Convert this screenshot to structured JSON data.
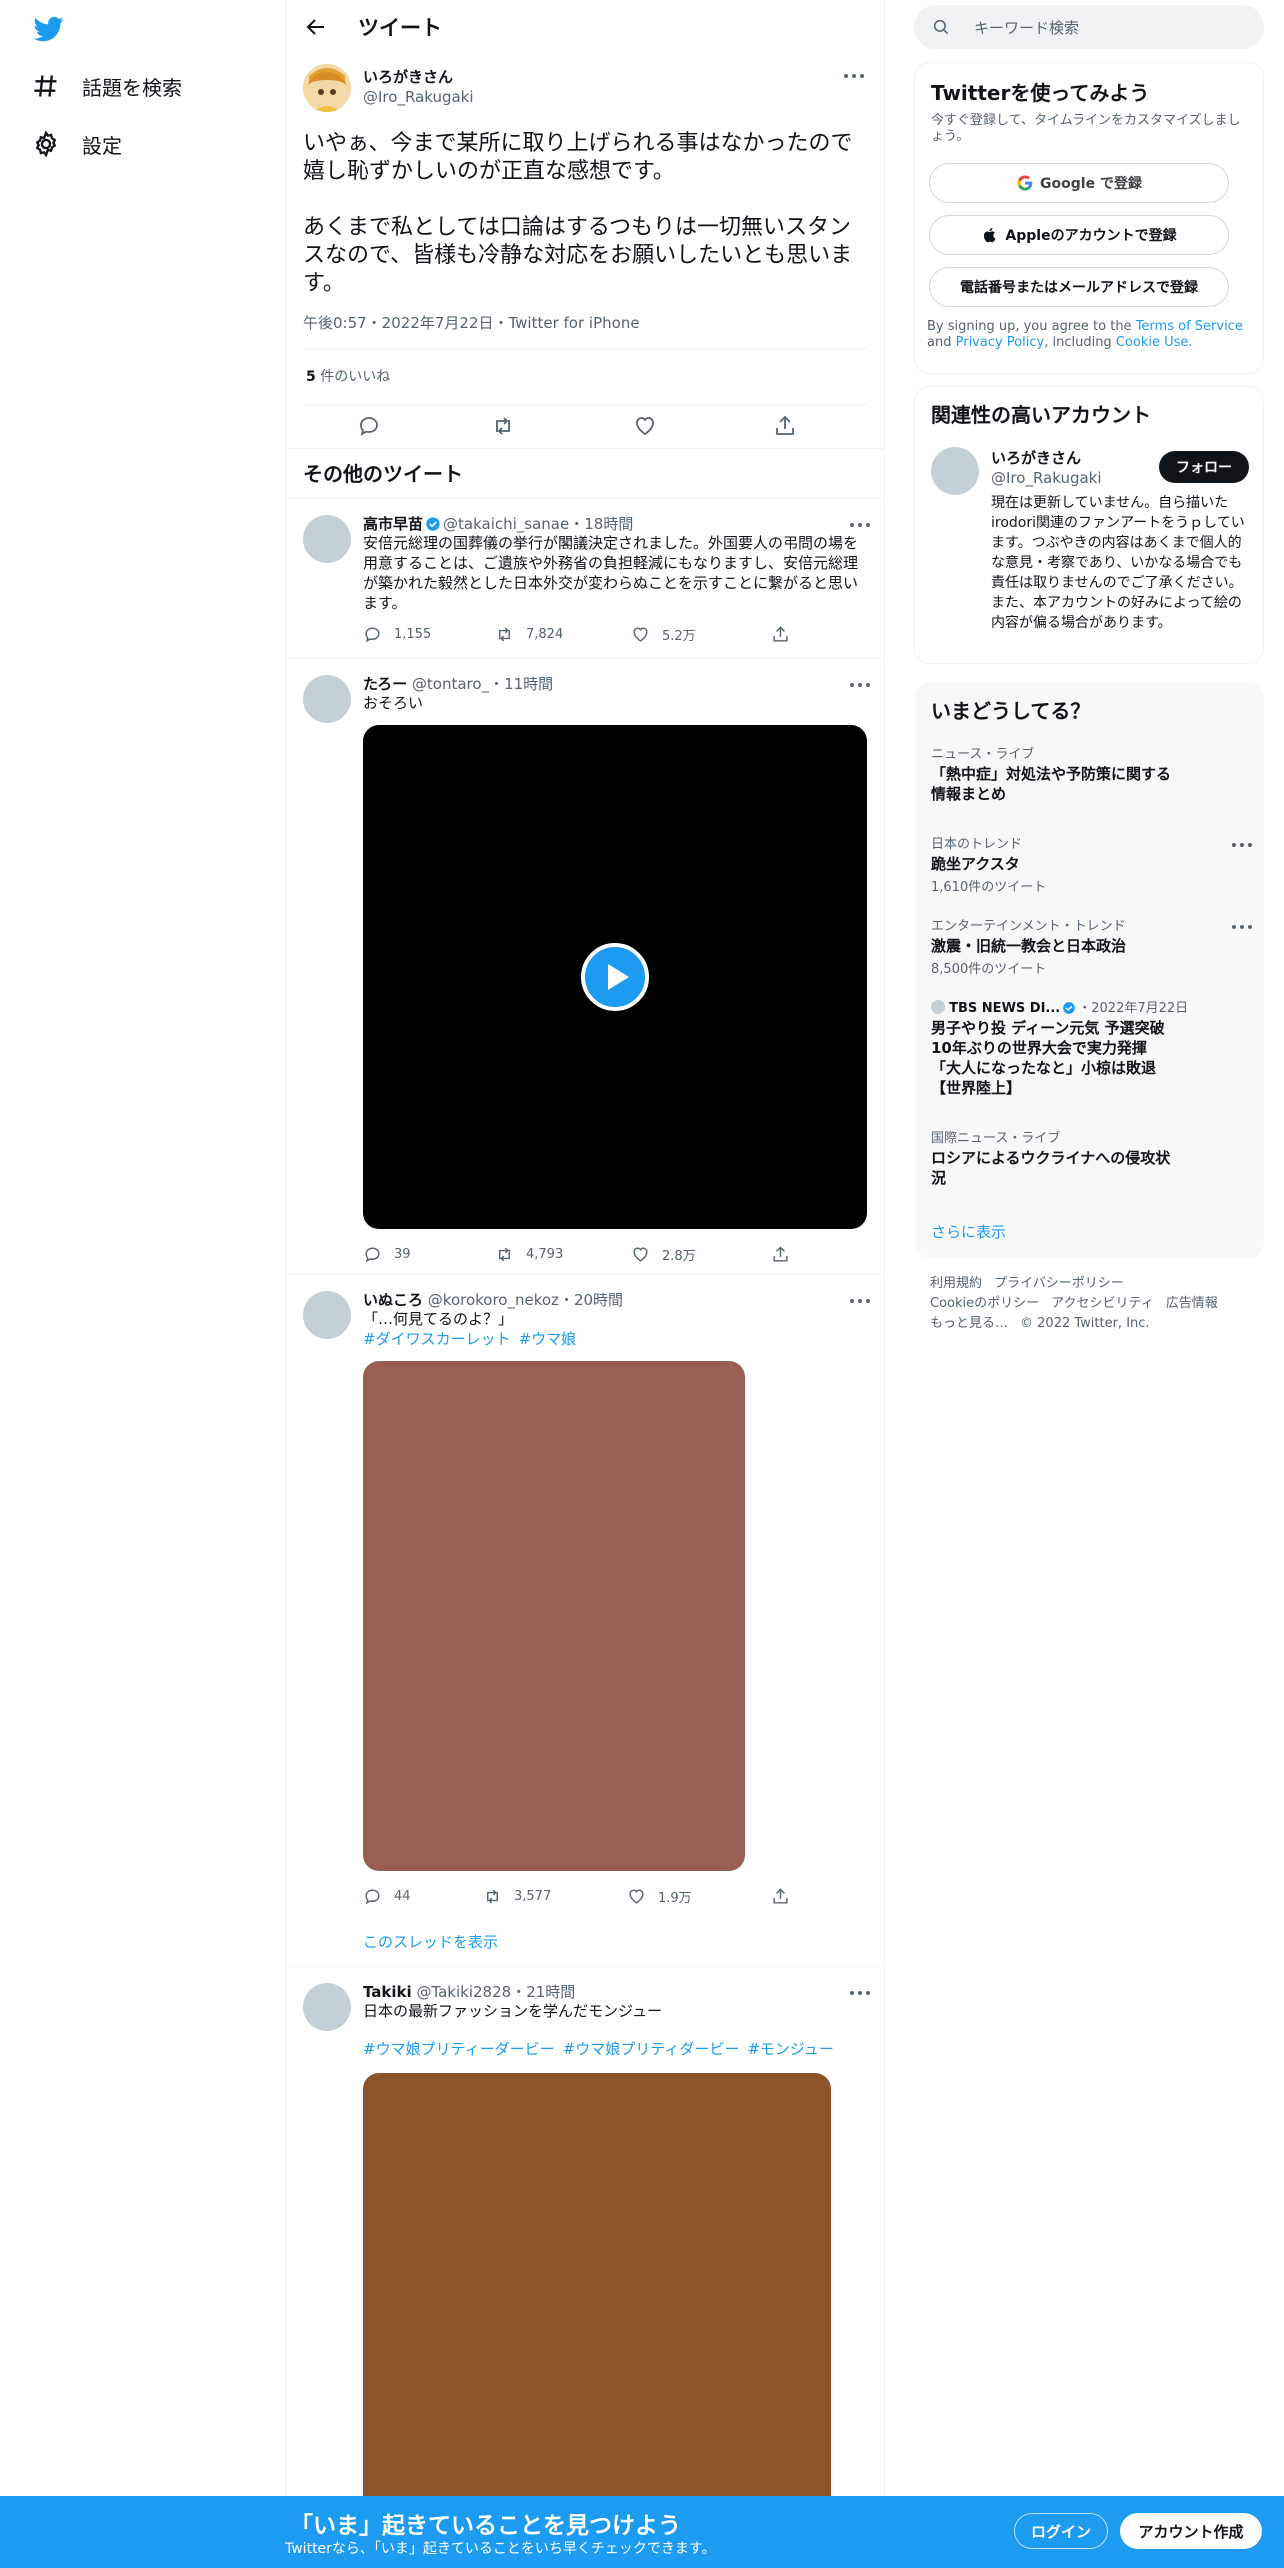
{
  "nav": {
    "logo": "twitter-bird-icon",
    "explore_label": "話題を検索",
    "settings_label": "設定"
  },
  "header": {
    "title": "ツイート"
  },
  "main_tweet": {
    "name": "いろがきさん",
    "handle": "@Iro_Rakugaki",
    "text": "いやぁ、今まで某所に取り上げられる事はなかったので嬉し恥ずかしいのが正直な感想です。\n\nあくまで私としては口論はするつもりは一切無いスタンスなので、皆様も冷静な対応をお願いしたいとも思います。",
    "meta": "午後0:57・2022年7月22日・Twitter for iPhone",
    "likes_count": "5",
    "likes_label": "件のいいね"
  },
  "more_tweets": {
    "title": "その他のツイート",
    "tweets": [
      {
        "name": "高市早苗",
        "handle": "@takaichi_sanae",
        "time": "18時間",
        "text": "安倍元総理の国葬儀の挙行が閣議決定されました。外国要人の弔問の場を用意することは、ご遺族や外務省の負担軽減にもなりますし、安倍元総理が築かれた毅然とした日本外交が変わらぬことを示すことに繋がると思います。",
        "replies": "1,155",
        "retweets": "7,824",
        "likes": "5.2万"
      },
      {
        "name": "たろー",
        "handle": "@tontaro_",
        "time": "11時間",
        "text": "おそろい",
        "replies": "39",
        "retweets": "4,793",
        "likes": "2.8万"
      },
      {
        "name": "いぬころ",
        "handle": "@korokoro_nekoz",
        "time": "20時間",
        "text": "「…何見てるのよ？」",
        "hashtags": [
          "#ダイワスカーレット",
          "#ウマ娘"
        ],
        "replies": "44",
        "retweets": "3,577",
        "likes": "1.9万",
        "show_thread": "このスレッドを表示",
        "media_color": "#985f52"
      },
      {
        "name": "Takiki",
        "handle": "@Takiki2828",
        "time": "21時間",
        "text": "日本の最新ファッションを学んだモンジュー",
        "hashtags": [
          "#ウマ娘プリティーダービー",
          "#ウマ娘プリティダービー",
          "#モンジュー"
        ],
        "media_color": "#8b5429"
      }
    ]
  },
  "search": {
    "placeholder": "キーワード検索"
  },
  "signup_card": {
    "title": "Twitterを使ってみよう",
    "subtitle": "今すぐ登録して、タイムラインをカスタマイズしましょう。",
    "google": "Google で登録",
    "apple": "Appleのアカウントで登録",
    "phone": "電話番号またはメールアドレスで登録",
    "legal_1": "By signing up, you agree to the",
    "terms": "Terms of Service",
    "legal_2": "and",
    "privacy": "Privacy Policy",
    "legal_3": ", including",
    "cookie": "Cookie Use."
  },
  "related": {
    "title": "関連性の高いアカウント",
    "name": "いろがきさん",
    "handle": "@Iro_Rakugaki",
    "follow": "フォロー",
    "bio": "現在は更新していません。自ら描いたirodori関連のファンアートをうｐしています。つぶやきの内容はあくまで個人的な意見・考察であり、いかなる場合でも責任は取りませんのでご了承ください。また、本アカウントの好みによって絵の内容が偏る場合があります。"
  },
  "trends": {
    "title": "いまどうしてる？",
    "items": [
      {
        "category": "ニュース・ライブ",
        "title": "「熱中症」対処法や予防策に関する情報まとめ"
      },
      {
        "category": "日本のトレンド",
        "title": "跪坐アクスタ",
        "count": "1,610件のツイート"
      },
      {
        "category": "エンターテインメント・トレンド",
        "title": "激震・旧統一教会と日本政治",
        "count": "8,500件のツイート"
      },
      {
        "source": "TBS NEWS DI...",
        "date": "2022年7月22日",
        "title": "男子やり投 ディーン元気 予選突破 10年ぶりの世界大会で実力発揮 「大人になったなと」小椋は敗退【世界陸上】"
      },
      {
        "category": "国際ニュース・ライブ",
        "title": "ロシアによるウクライナへの侵攻状況"
      }
    ],
    "show_more": "さらに表示"
  },
  "footer": {
    "terms": "利用規約",
    "privacy": "プライバシーポリシー",
    "cookie": "Cookieのポリシー",
    "accessibility": "アクセシビリティ",
    "ads": "広告情報",
    "more": "もっと見る…",
    "copyright": "© 2022 Twitter, Inc."
  },
  "bottom_bar": {
    "title": "「いま」起きていることを見つけよう",
    "subtitle": "Twitterなら、「いま」起きていることをいち早くチェックできます。",
    "login": "ログイン",
    "signup": "アカウント作成"
  },
  "colors": {
    "accent": "#1d9bf0",
    "text": "#0f1419",
    "secondary": "#536471"
  }
}
